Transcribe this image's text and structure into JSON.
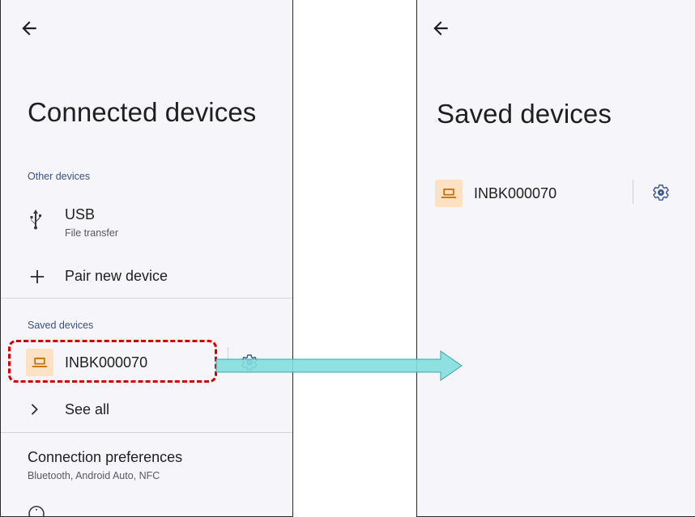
{
  "left_screen": {
    "title": "Connected devices",
    "other_devices_header": "Other devices",
    "usb": {
      "label": "USB",
      "sublabel": "File transfer",
      "icon": "usb-icon"
    },
    "pair_new": {
      "label": "Pair new device",
      "icon": "plus-icon"
    },
    "saved_devices_header": "Saved devices",
    "saved_device": {
      "label": "INBK000070",
      "icon": "laptop-icon",
      "settings_icon": "gear-icon"
    },
    "see_all": {
      "label": "See all",
      "icon": "chevron-right-icon"
    },
    "connection_prefs": {
      "label": "Connection preferences",
      "sublabel": "Bluetooth, Android Auto, NFC"
    }
  },
  "right_screen": {
    "title": "Saved devices",
    "saved_device": {
      "label": "INBK000070",
      "icon": "laptop-icon",
      "settings_icon": "gear-icon"
    }
  },
  "colors": {
    "screen_bg": "#f6f5f9",
    "section_header": "#3b4f7e",
    "laptop_tile": "#fde1c3",
    "laptop_glyph": "#c86a00",
    "gear": "#3f5793",
    "highlight": "#d40000",
    "arrow_fill": "#84dede",
    "arrow_stroke": "#3aa6a6"
  }
}
